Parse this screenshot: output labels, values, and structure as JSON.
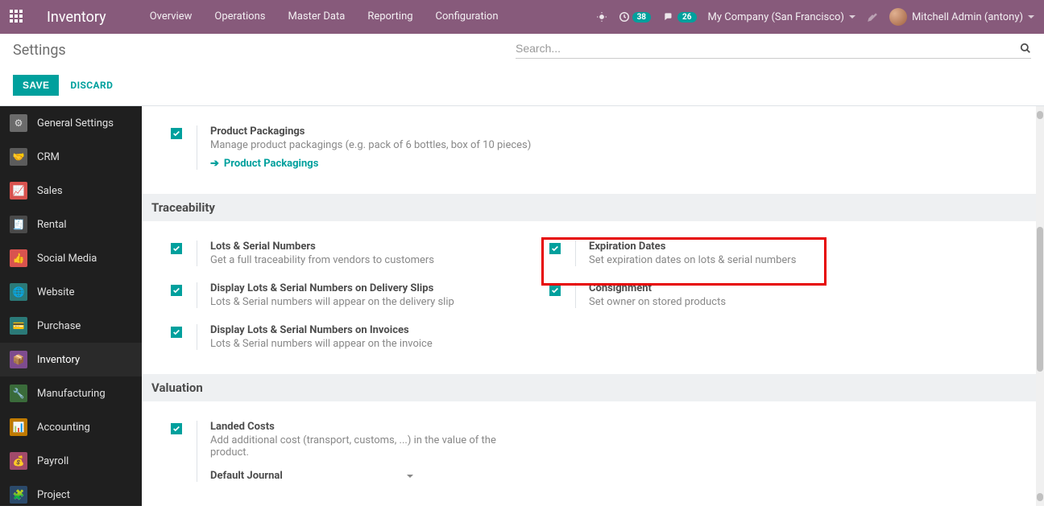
{
  "topnav": {
    "brand": "Inventory",
    "menu": [
      "Overview",
      "Operations",
      "Master Data",
      "Reporting",
      "Configuration"
    ],
    "badge_activity": "38",
    "badge_discuss": "26",
    "company": "My Company (San Francisco)",
    "user": "Mitchell Admin (antony)"
  },
  "control": {
    "title": "Settings",
    "search_placeholder": "Search..."
  },
  "buttons": {
    "save": "SAVE",
    "discard": "DISCARD"
  },
  "sidebar": {
    "items": [
      {
        "label": "General Settings",
        "color": "#6b6b6b",
        "glyph": "⚙"
      },
      {
        "label": "CRM",
        "color": "#5c5c5c",
        "glyph": "🤝"
      },
      {
        "label": "Sales",
        "color": "#d9534f",
        "glyph": "📈"
      },
      {
        "label": "Rental",
        "color": "#4a4a4a",
        "glyph": "🧾"
      },
      {
        "label": "Social Media",
        "color": "#d9534f",
        "glyph": "👍"
      },
      {
        "label": "Website",
        "color": "#2b7a78",
        "glyph": "🌐"
      },
      {
        "label": "Purchase",
        "color": "#2b7a78",
        "glyph": "💳"
      },
      {
        "label": "Inventory",
        "color": "#7e4c8f",
        "glyph": "📦"
      },
      {
        "label": "Manufacturing",
        "color": "#3a6b3a",
        "glyph": "🔧"
      },
      {
        "label": "Accounting",
        "color": "#c07a00",
        "glyph": "📊"
      },
      {
        "label": "Payroll",
        "color": "#a04a6a",
        "glyph": "💰"
      },
      {
        "label": "Project",
        "color": "#2b4a6b",
        "glyph": "🧩"
      }
    ]
  },
  "settings": {
    "top_block": {
      "title": "Product Packagings",
      "desc": "Manage product packagings (e.g. pack of 6 bottles, box of 10 pieces)",
      "link": "Product Packagings"
    },
    "section_traceability": "Traceability",
    "trace_left": [
      {
        "title": "Lots & Serial Numbers",
        "desc": "Get a full traceability from vendors to customers"
      },
      {
        "title": "Display Lots & Serial Numbers on Delivery Slips",
        "desc": "Lots & Serial numbers will appear on the delivery slip"
      },
      {
        "title": "Display Lots & Serial Numbers on Invoices",
        "desc": "Lots & Serial numbers will appear on the invoice"
      }
    ],
    "trace_right": [
      {
        "title": "Expiration Dates",
        "desc": "Set expiration dates on lots & serial numbers"
      },
      {
        "title": "Consignment",
        "desc": "Set owner on stored products"
      }
    ],
    "section_valuation": "Valuation",
    "landed": {
      "title": "Landed Costs",
      "desc": "Add additional cost (transport, customs, ...) in the value of the product."
    },
    "journal_label": "Default Journal"
  }
}
